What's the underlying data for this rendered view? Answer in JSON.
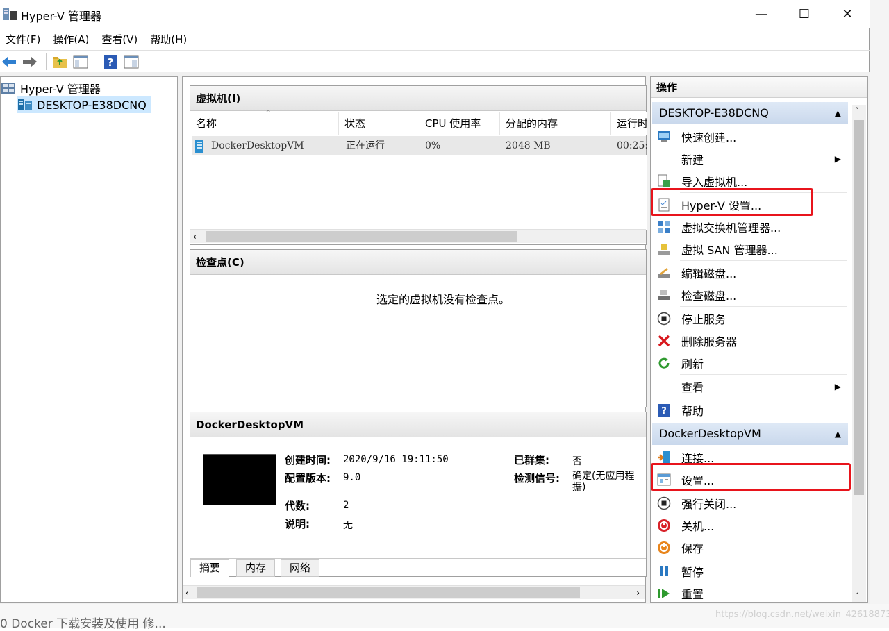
{
  "window": {
    "title": "Hyper-V 管理器"
  },
  "menu": [
    "文件(F)",
    "操作(A)",
    "查看(V)",
    "帮助(H)"
  ],
  "tree": {
    "root": "Hyper-V 管理器",
    "server": "DESKTOP-E38DCNQ"
  },
  "vms": {
    "header": "虚拟机(I)",
    "columns": [
      "名称",
      "状态",
      "CPU 使用率",
      "分配的内存",
      "运行时"
    ],
    "rows": [
      {
        "name": "DockerDesktopVM",
        "status": "正在运行",
        "cpu": "0%",
        "memory": "2048 MB",
        "uptime": "00:25:"
      }
    ]
  },
  "checkpoints": {
    "header": "检查点(C)",
    "empty_text": "选定的虚拟机没有检查点。"
  },
  "details": {
    "header": "DockerDesktopVM",
    "created_label": "创建时间:",
    "created": "2020/9/16 19:11:50",
    "config_label": "配置版本:",
    "config": "9.0",
    "gen_label": "代数:",
    "gen": "2",
    "notes_label": "说明:",
    "notes": "无",
    "clustered_label": "已群集:",
    "clustered": "否",
    "heartbeat_label": "检测信号:",
    "heartbeat": "确定(无应用程",
    "heartbeat_cont": "据)",
    "tabs": [
      "摘要",
      "内存",
      "网络"
    ]
  },
  "actions": {
    "title": "操作",
    "group1": "DESKTOP-E38DCNQ",
    "group1_items": [
      "快速创建...",
      "新建",
      "导入虚拟机...",
      "Hyper-V 设置...",
      "虚拟交换机管理器...",
      "虚拟 SAN 管理器...",
      "编辑磁盘...",
      "检查磁盘...",
      "停止服务",
      "删除服务器",
      "刷新",
      "查看",
      "帮助"
    ],
    "group2": "DockerDesktopVM",
    "group2_items": [
      "连接...",
      "设置...",
      "强行关闭...",
      "关机...",
      "保存",
      "暂停",
      "重置"
    ]
  },
  "background": {
    "page_text": "0 Docker 下载安装及使用 修...",
    "watermark": "https://blog.csdn.net/weixin_42618873"
  },
  "colors": {
    "highlight": "#e8141c",
    "selection": "#cce8ff",
    "group_header": "#c9d8ec"
  }
}
